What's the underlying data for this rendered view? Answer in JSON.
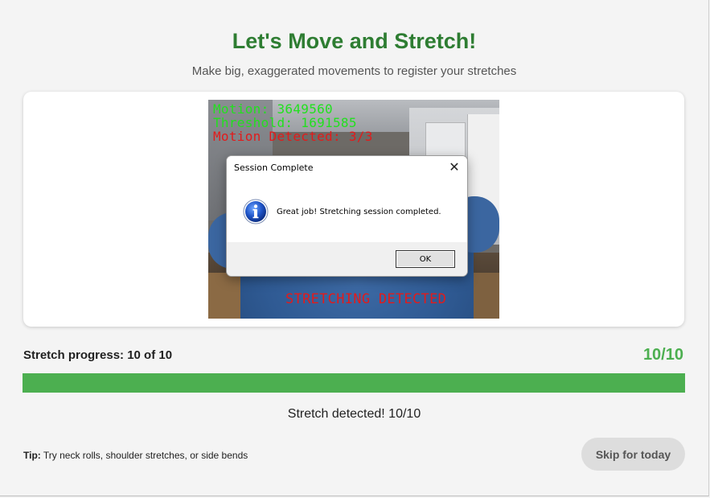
{
  "header": {
    "title": "Let's Move and Stretch!",
    "subtitle": "Make big, exaggerated movements to register your stretches"
  },
  "camera_overlay": {
    "motion": "Motion: 3649560",
    "threshold": "Threshold: 1691585",
    "motion_detected": "Motion Detected: 3/3",
    "stretching_banner": "STRETCHING DETECTED"
  },
  "progress": {
    "label": "Stretch progress: 10 of 10",
    "count": "10/10",
    "fraction": 1.0
  },
  "status": "Stretch detected! 10/10",
  "tip": {
    "prefix": "Tip:",
    "text": "Try neck rolls, shoulder stretches, or side bends"
  },
  "skip_button": "Skip for today",
  "dialog": {
    "title": "Session Complete",
    "message": "Great job! Stretching session completed.",
    "ok_label": "OK",
    "icon": "info-icon"
  },
  "colors": {
    "title_green": "#2e7d32",
    "progress_green": "#4caf50",
    "overlay_green": "#22e01f",
    "overlay_red": "#e21b1b"
  }
}
